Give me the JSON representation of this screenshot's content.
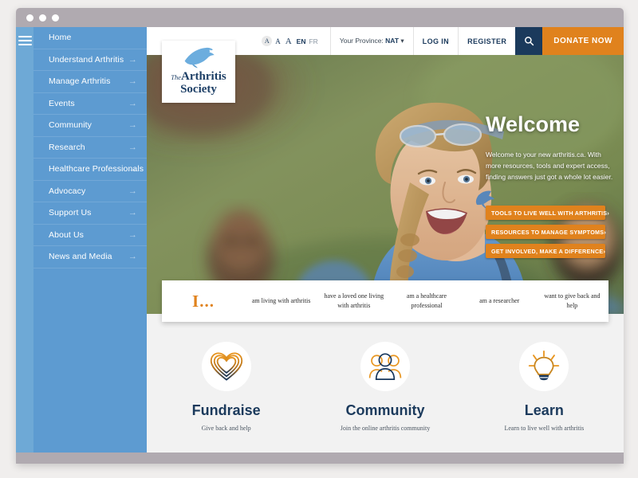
{
  "window": {
    "dots": [
      "close-dot",
      "minimize-dot",
      "maximize-dot"
    ]
  },
  "sidebar": {
    "menu_icon": "hamburger-icon",
    "items": [
      {
        "label": "Home",
        "arrow": ""
      },
      {
        "label": "Understand Arthritis",
        "arrow": "→"
      },
      {
        "label": "Manage Arthritis",
        "arrow": "→"
      },
      {
        "label": "Events",
        "arrow": "→"
      },
      {
        "label": "Community",
        "arrow": "→"
      },
      {
        "label": "Research",
        "arrow": "→"
      },
      {
        "label": "Healthcare Professionals",
        "arrow": "→"
      },
      {
        "label": "Advocacy",
        "arrow": "→"
      },
      {
        "label": "Support Us",
        "arrow": "→"
      },
      {
        "label": "About Us",
        "arrow": "→"
      },
      {
        "label": "News and Media",
        "arrow": "→"
      }
    ]
  },
  "logo": {
    "line1": "The",
    "line2": "Arthritis",
    "line3": "Society",
    "bird_icon": "bird-icon"
  },
  "topbar": {
    "text_size_small": "A",
    "text_size_medium": "A",
    "text_size_large": "A",
    "lang_en": "EN",
    "lang_fr": "FR",
    "province_label": "Your Province:",
    "province_value": "NAT",
    "province_caret": "▾",
    "login": "LOG IN",
    "register": "REGISTER",
    "search_icon": "search-icon",
    "donate": "DONATE NOW"
  },
  "hero": {
    "title": "Welcome",
    "subtitle": "Welcome to your new arthritis.ca. With more resources, tools and expert access, finding answers just got a whole lot easier.",
    "ctas": [
      {
        "label": "TOOLS TO LIVE WELL WITH ARTHRITIS",
        "arrow": "›"
      },
      {
        "label": "RESOURCES TO MANAGE SYMPTOMS",
        "arrow": "›"
      },
      {
        "label": "GET INVOLVED, MAKE A DIFFERENCE",
        "arrow": "›"
      }
    ]
  },
  "persona": {
    "label": "I...",
    "options": [
      "am living with arthritis",
      "have a loved one living with arthritis",
      "am a healthcare professional",
      "am a researcher",
      "want to give back and help"
    ]
  },
  "features": [
    {
      "icon": "heart-icon",
      "title": "Fundraise",
      "desc": "Give back and help"
    },
    {
      "icon": "people-icon",
      "title": "Community",
      "desc": "Join the online arthritis community"
    },
    {
      "icon": "lightbulb-icon",
      "title": "Learn",
      "desc": "Learn to live well with arthritis"
    }
  ],
  "colors": {
    "sidebar_blue": "#5d9bd1",
    "rail_blue": "#6ea9d6",
    "navy": "#1b3a5c",
    "orange": "#e0821d",
    "page_bg": "#f2f2f2",
    "frame_grey": "#b0aab0"
  }
}
